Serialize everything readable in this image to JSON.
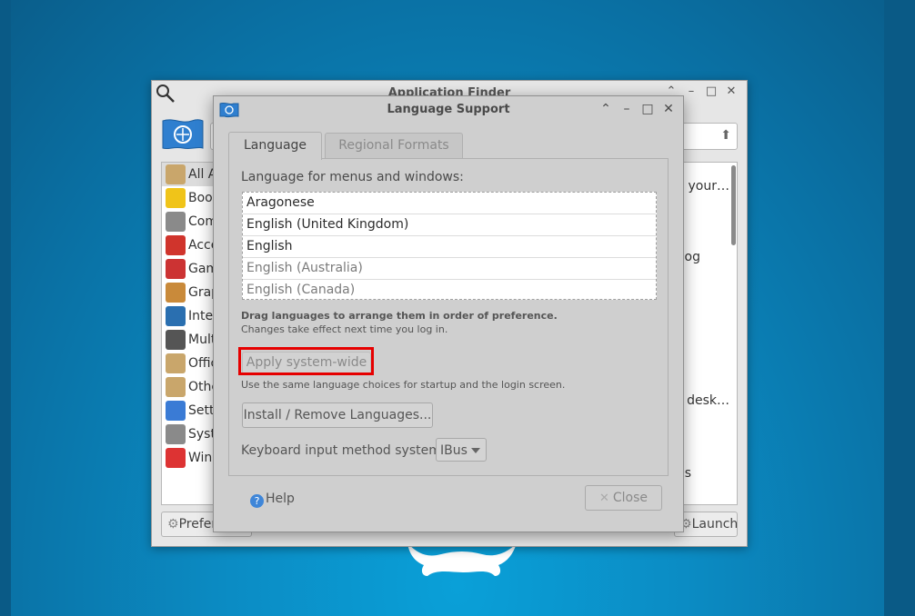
{
  "finder": {
    "title": "Application Finder",
    "window_controls": [
      "⌃",
      "–",
      "□",
      "✕"
    ],
    "search_arrow": "⬆",
    "categories": [
      {
        "label": "All A",
        "icon": "all-applications-icon",
        "color": "#c9a66b"
      },
      {
        "label": "Book",
        "icon": "bookmarks-star-icon",
        "color": "#f0c419"
      },
      {
        "label": "Com",
        "icon": "gears-icon",
        "color": "#8a8a8a"
      },
      {
        "label": "Acce",
        "icon": "accessories-knife-icon",
        "color": "#d0342c"
      },
      {
        "label": "Gam",
        "icon": "joystick-icon",
        "color": "#c33"
      },
      {
        "label": "Grap",
        "icon": "palette-icon",
        "color": "#c98a3a"
      },
      {
        "label": "Inter",
        "icon": "globe-icon",
        "color": "#2a6fb0"
      },
      {
        "label": "Mult",
        "icon": "multimedia-icon",
        "color": "#555"
      },
      {
        "label": "Offic",
        "icon": "office-icon",
        "color": "#c9a66b"
      },
      {
        "label": "Othe",
        "icon": "other-icon",
        "color": "#c9a66b"
      },
      {
        "label": "Setti",
        "icon": "settings-icon",
        "color": "#3a7bd5"
      },
      {
        "label": "Syst",
        "icon": "system-gear-icon",
        "color": "#8a8a8a"
      },
      {
        "label": "Wine",
        "icon": "wine-icon",
        "color": "#d33"
      }
    ],
    "app_fragments": [
      "on your…",
      "og",
      "d desk…",
      "s"
    ],
    "preferences_label": "Prefer",
    "launch_label": "Launch"
  },
  "dialog": {
    "title": "Language Support",
    "window_controls": [
      "⌃",
      "–",
      "□",
      "✕"
    ],
    "tabs": [
      "Language",
      "Regional Formats"
    ],
    "menus_label": "Language for menus and windows:",
    "languages": [
      {
        "name": "Aragonese",
        "dim": false
      },
      {
        "name": "English (United Kingdom)",
        "dim": false
      },
      {
        "name": "English",
        "dim": false
      },
      {
        "name": "English (Australia)",
        "dim": true
      },
      {
        "name": "English (Canada)",
        "dim": true
      }
    ],
    "drag_hint": "Drag languages to arrange them in order of preference.",
    "changes_hint": "Changes take effect next time you log in.",
    "apply_label": "Apply system-wide",
    "apply_hint": "Use the same language choices for startup and the login screen.",
    "install_label": "Install / Remove Languages...",
    "keyboard_label": "Keyboard input method system:",
    "keyboard_value": "IBus",
    "help_label": "Help",
    "close_label": "Close"
  },
  "colors": {
    "highlight": "#e60000",
    "desktop": "#0a8cc4"
  }
}
